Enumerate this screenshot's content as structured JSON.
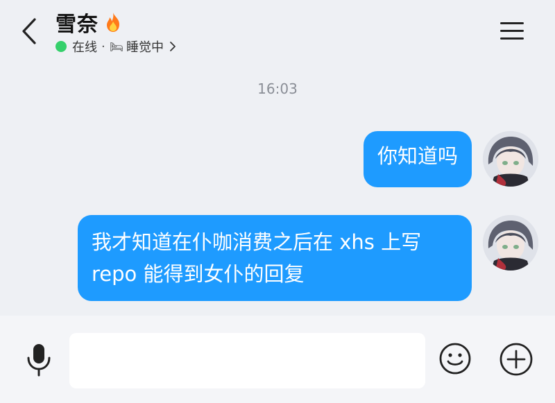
{
  "header": {
    "contact_name": "雪奈",
    "status_text": "在线",
    "separator": "·",
    "activity_icon": "🛏",
    "activity_text": "睡觉中",
    "icons": {
      "back": "chevron-left-icon",
      "fire": "fire-icon",
      "menu": "hamburger-menu-icon",
      "status_arrow": "chevron-right-icon"
    }
  },
  "chat": {
    "timestamp": "16:03",
    "messages": [
      {
        "sender": "me",
        "lines": [
          "你知道吗"
        ]
      },
      {
        "sender": "me",
        "lines": [
          "我才知道在仆咖消费之后在 xhs 上写",
          "repo 能得到女仆的回复"
        ]
      }
    ]
  },
  "input_bar": {
    "placeholder": "",
    "value": "",
    "icons": {
      "mic": "microphone-icon",
      "emoji": "smiley-icon",
      "more": "plus-circle-icon"
    }
  },
  "colors": {
    "bubble": "#1e9bff",
    "background": "#eef0f4",
    "online": "#35d06b",
    "input_bar": "#f4f5f8"
  }
}
